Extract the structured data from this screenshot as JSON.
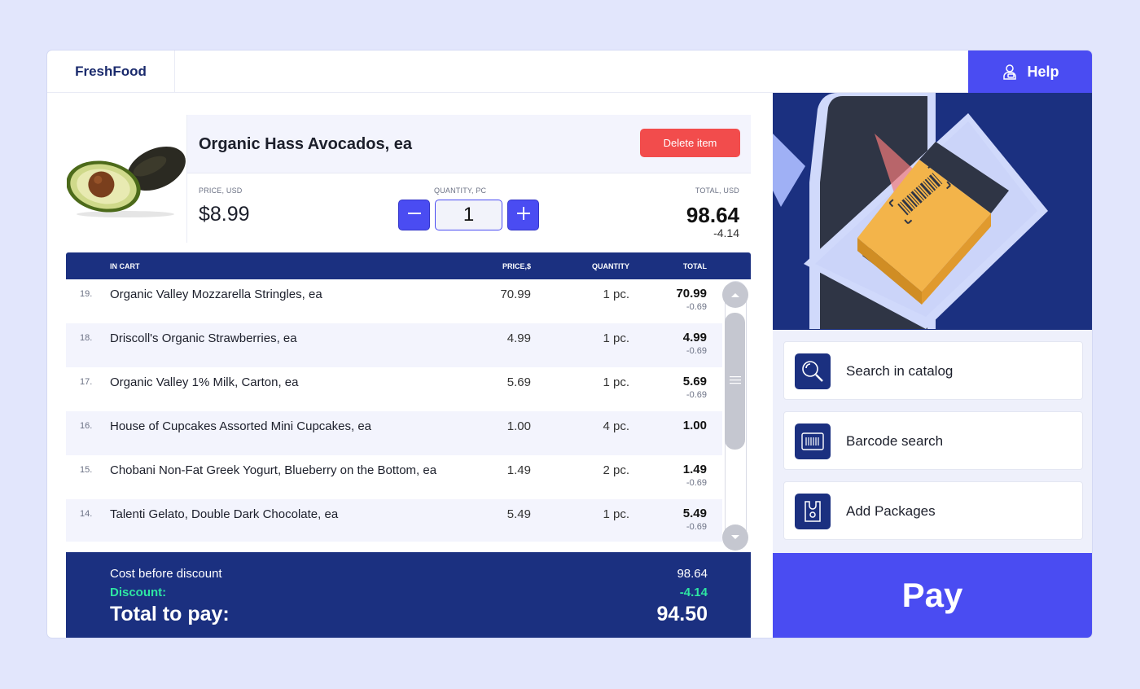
{
  "header": {
    "brand": "FreshFood",
    "help_label": "Help"
  },
  "product": {
    "name": "Organic Hass Avocados, ea",
    "delete_label": "Delete item",
    "price_label": "PRICE, USD",
    "price": "$8.99",
    "quantity_label": "QUANTITY, PC",
    "quantity": "1",
    "total_label": "TOTAL, USD",
    "total": "98.64",
    "discount": "-4.14"
  },
  "cart": {
    "headers": {
      "in_cart": "IN CART",
      "price": "PRICE,$",
      "quantity": "QUANTITY",
      "total": "TOTAL"
    },
    "rows": [
      {
        "num": "19.",
        "name": "Organic Valley Mozzarella Stringles, ea",
        "price": "70.99",
        "qty": "1 pc.",
        "total": "70.99",
        "discount": "-0.69"
      },
      {
        "num": "18.",
        "name": "Driscoll's Organic Strawberries, ea",
        "price": "4.99",
        "qty": "1 pc.",
        "total": "4.99",
        "discount": "-0.69"
      },
      {
        "num": "17.",
        "name": "Organic Valley 1% Milk, Carton, ea",
        "price": "5.69",
        "qty": "1 pc.",
        "total": "5.69",
        "discount": "-0.69"
      },
      {
        "num": "16.",
        "name": "House of Cupcakes Assorted Mini Cupcakes, ea",
        "price": "1.00",
        "qty": "4 pc.",
        "total": "1.00",
        "discount": ""
      },
      {
        "num": "15.",
        "name": "Chobani Non-Fat Greek Yogurt, Blueberry on the Bottom, ea",
        "price": "1.49",
        "qty": "2 pc.",
        "total": "1.49",
        "discount": "-0.69"
      },
      {
        "num": "14.",
        "name": "Talenti Gelato, Double Dark Chocolate, ea",
        "price": "5.49",
        "qty": "1 pc.",
        "total": "5.49",
        "discount": "-0.69"
      }
    ]
  },
  "summary": {
    "cost_label": "Cost before discount",
    "cost": "98.64",
    "discount_label": "Discount:",
    "discount": "-4.14",
    "total_label": "Total to pay:",
    "total": "94.50"
  },
  "actions": {
    "search_catalog": "Search in catalog",
    "barcode_search": "Barcode search",
    "add_packages": "Add Packages"
  },
  "pay_label": "Pay",
  "colors": {
    "accent": "#4a4cf2",
    "navy": "#1b3080",
    "danger": "#f24c4c",
    "discount": "#2ee6a2"
  }
}
